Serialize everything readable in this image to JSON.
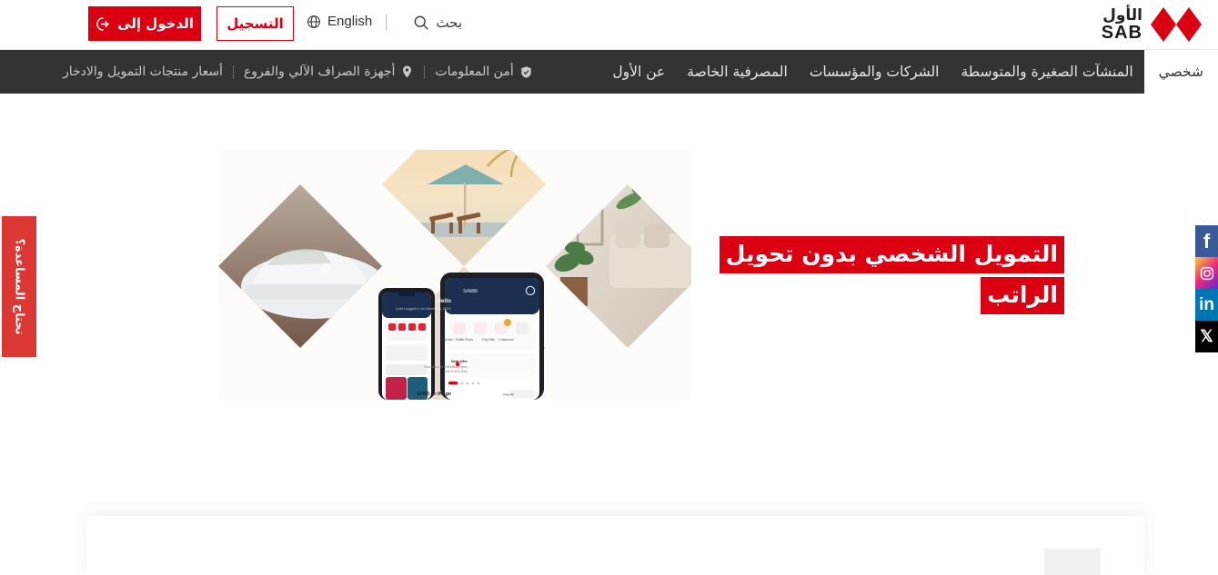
{
  "brand": {
    "name_ar": "الأول",
    "name_en": "SAB",
    "logo_icon": "sab-hexagon-logo",
    "accent": "#db0011"
  },
  "utility_bar": {
    "login_button": {
      "label": "الدخول إلى",
      "icon": "login-arrow-icon"
    },
    "register_button": {
      "label": "التسجيل"
    },
    "language_switch": {
      "label": "English",
      "icon": "globe-icon"
    },
    "search": {
      "label": "بحث",
      "icon": "search-icon"
    },
    "divider": "|"
  },
  "main_nav": {
    "primary_items": [
      {
        "label": "شخصي",
        "active": true
      },
      {
        "label": "المنشآت الصغيرة والمتوسطة",
        "active": false
      },
      {
        "label": "الشركات والمؤسسات",
        "active": false
      },
      {
        "label": "المصرفية الخاصة",
        "active": false
      },
      {
        "label": "عن الأول",
        "active": false
      }
    ],
    "secondary_items": [
      {
        "label": "أمن المعلومات",
        "icon": "shield-check-icon"
      },
      {
        "label": "أجهزة الصراف الآلي والفروع",
        "icon": "location-pin-icon"
      },
      {
        "label": "أسعار منتجات التمويل والادخار",
        "icon": ""
      }
    ],
    "background": "#333333"
  },
  "hero": {
    "headline_line1": "التمويل الشخصي بدون تحويل",
    "headline_line2": "الراتب",
    "headline_bg": "#db0011",
    "image": {
      "name": "personal-finance-diamond-collage",
      "panels": [
        "white-car",
        "beach-sunset-umbrella",
        "living-room-interior",
        "sab-mobile-app-phones"
      ],
      "app_screen": {
        "bank_name": "SABB",
        "greeting": "Hello",
        "last_login": "Last Logged in on March 10, 2021 at 3:46 PM",
        "quick_actions": [
          "Transfer",
          "Traffic Fines",
          "Pay Bills",
          "Customize"
        ],
        "offer_title": "New offer",
        "offer_text": "Description of notifications goes here in here lines",
        "footer_title": "SABB on the go",
        "footer_link": "View All"
      }
    }
  },
  "help_tab": {
    "label": "تحتاج المساعدة؟",
    "color": "#db3833"
  },
  "social_rail": [
    {
      "name": "facebook",
      "glyph": "f",
      "color": "#3b5998"
    },
    {
      "name": "instagram",
      "glyph": "",
      "color": "#ee2a7b"
    },
    {
      "name": "linkedin",
      "glyph": "in",
      "color": "#0077b5"
    },
    {
      "name": "x-twitter",
      "glyph": "𝕏",
      "color": "#000000"
    }
  ],
  "bottom_card": {
    "placeholder_box": ""
  }
}
